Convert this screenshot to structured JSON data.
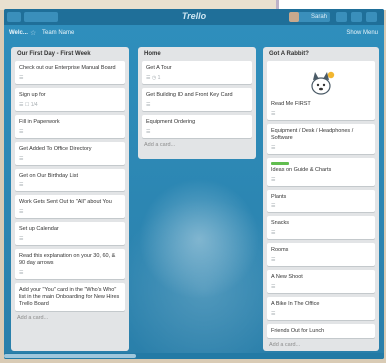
{
  "app": {
    "logo": "Trello",
    "username": "Sarah"
  },
  "board": {
    "title": "Welc...",
    "team_label": "Team Name",
    "menu_label": "Show Menu"
  },
  "lists": [
    {
      "title": "Our First Day - First Week",
      "cards": [
        {
          "title": "Check out our Enterprise Manual Board",
          "meta": "☰"
        },
        {
          "title": "Sign up for",
          "meta": "☰  ☐ 1/4"
        },
        {
          "title": "Fill in Paperwork",
          "meta": "☰"
        },
        {
          "title": "Get Added To Office Directory",
          "meta": "☰"
        },
        {
          "title": "Get on Our Birthday List",
          "meta": "☰"
        },
        {
          "title": "Work Gets Sent Out to \"All\" about You",
          "meta": "☰"
        },
        {
          "title": "Set up Calendar",
          "meta": "☰"
        },
        {
          "title": "Read this explanation on your 30, 60, & 90 day arrows",
          "meta": "☰"
        },
        {
          "title": "Add your \"You\" card in the \"Who's Who\" list in the main Onboarding for New Hires Trello Board",
          "meta": ""
        }
      ],
      "add": "Add a card..."
    },
    {
      "title": "Home",
      "cards": [
        {
          "title": "Get A Tour",
          "meta": "☰  ◷ 1"
        },
        {
          "title": "Get Building ID and Front Key Card",
          "meta": "☰"
        },
        {
          "title": "Equipment Ordering",
          "meta": "☰"
        }
      ],
      "add": "Add a card..."
    },
    {
      "title": "Got A Rabbit?",
      "cards": [
        {
          "title": "Read Me FIRST",
          "meta": "☰",
          "mascot": true
        },
        {
          "title": "Equipment / Desk / Headphones / Software",
          "meta": "☰"
        },
        {
          "title": "Ideas on Guide & Charts",
          "meta": "☰",
          "label": true
        },
        {
          "title": "Plants",
          "meta": "☰"
        },
        {
          "title": "Snacks",
          "meta": "☰"
        },
        {
          "title": "Rooms",
          "meta": "☰"
        },
        {
          "title": "A New Shoot",
          "meta": "☰"
        },
        {
          "title": "A Bike In The Office",
          "meta": "☰"
        },
        {
          "title": "Friends Out for Lunch",
          "meta": ""
        }
      ],
      "add": "Add a card..."
    }
  ]
}
